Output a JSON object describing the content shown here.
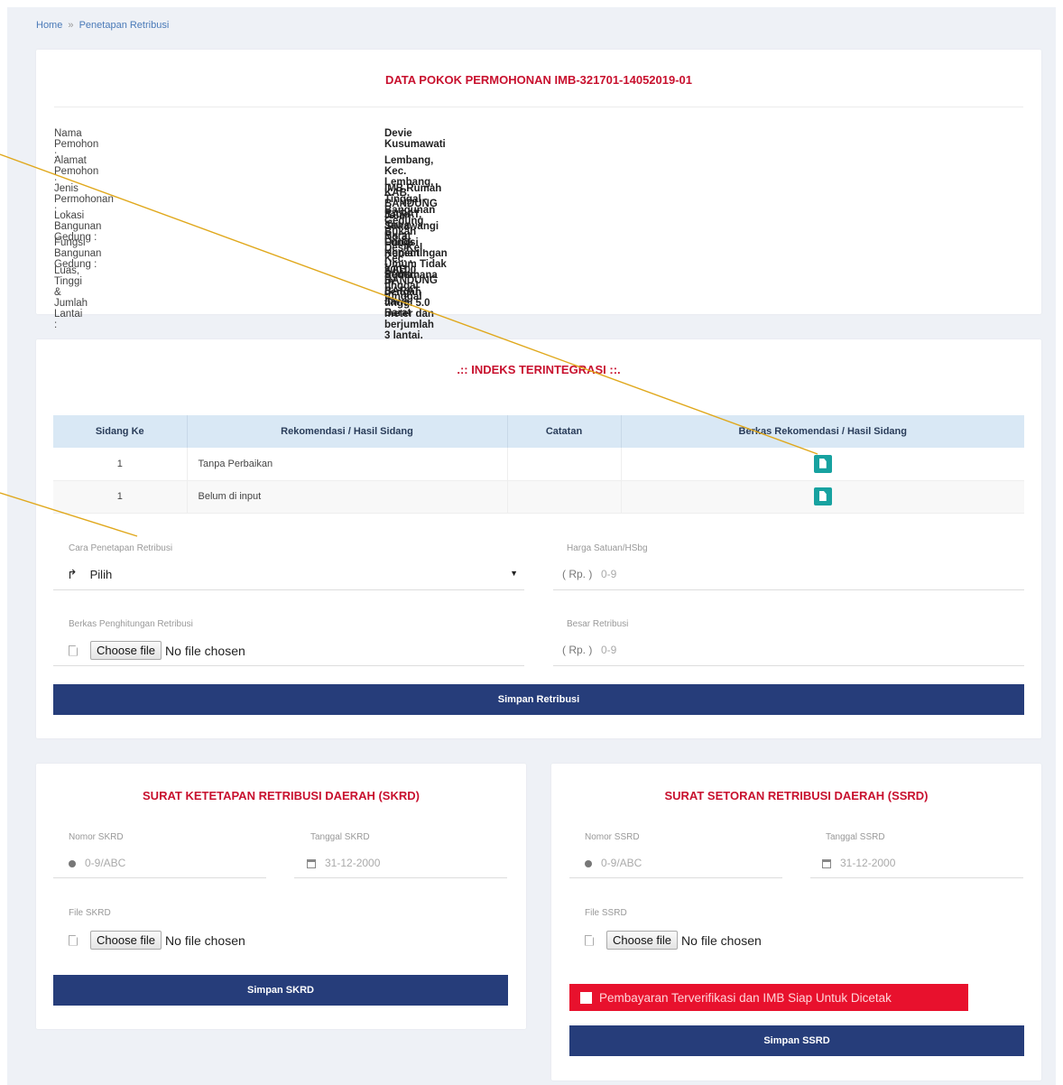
{
  "breadcrumb": {
    "home": "Home",
    "sep": "»",
    "current": "Penetapan Retribusi"
  },
  "data_pokok": {
    "title": "DATA POKOK PERMOHONAN IMB-321701-14052019-01",
    "rows": [
      {
        "label": "Nama Pemohon :",
        "value": "Devie Kusumawati"
      },
      {
        "label": "Alamat Pemohon :",
        "value": "Lembang, Kec. Lembang, KAB. BANDUNG BARAT, Jawa Barat"
      },
      {
        "label": "Jenis Permohonan :",
        "value": "IMB Rumah Tinggal - Bangunan Gedung Bukan Untuk Kepentingan Umum Tidak Sederhana"
      },
      {
        "label": "Lokasi Bangunan Gedung :",
        "value": "Jalan Sukawangi No 3, Des/Kel. Kec. , KAB. BANDUNG BARAT, Jawa Barat"
      },
      {
        "label": "Fungsi Bangunan Gedung :",
        "value": "Fungsi Hunian - Rumah tinggal tunggal"
      },
      {
        "label": "Luas, Tinggi & Jumlah Lantai :",
        "value": "200.00 m², dengan tinggi 5.0 meter dan berjumlah 3 lantai."
      }
    ]
  },
  "indeks": {
    "title": ".:: INDEKS TERINTEGRASI ::.",
    "headers": [
      "Sidang Ke",
      "Rekomendasi / Hasil Sidang",
      "Catatan",
      "Berkas Rekomendasi / Hasil Sidang"
    ],
    "rows": [
      {
        "sidang": "1",
        "hasil": "Tanpa Perbaikan",
        "catatan": ""
      },
      {
        "sidang": "1",
        "hasil": "Belum di input",
        "catatan": ""
      }
    ],
    "doc_icon": "document-icon"
  },
  "retribusi": {
    "cara_label": "Cara Penetapan Retribusi",
    "cara_value": "Pilih",
    "harga_label": "Harga Satuan/HSbg",
    "harga_prefix": "( Rp. )",
    "harga_placeholder": "0-9",
    "berkas_label": "Berkas Penghitungan Retribusi",
    "choose_file": "Choose file",
    "no_file": "No file chosen",
    "besar_label": "Besar Retribusi",
    "besar_prefix": "( Rp. )",
    "besar_placeholder": "0-9",
    "save_label": "Simpan Retribusi"
  },
  "skrd": {
    "title": "SURAT KETETAPAN RETRIBUSI DAERAH (SKRD)",
    "nomor_label": "Nomor SKRD",
    "nomor_placeholder": "0-9/ABC",
    "tanggal_label": "Tanggal SKRD",
    "tanggal_placeholder": "31-12-2000",
    "file_label": "File SKRD",
    "choose_file": "Choose file",
    "no_file": "No file chosen",
    "save_label": "Simpan SKRD"
  },
  "ssrd": {
    "title": "SURAT SETORAN RETRIBUSI DAERAH (SSRD)",
    "nomor_label": "Nomor SSRD",
    "nomor_placeholder": "0-9/ABC",
    "tanggal_label": "Tanggal SSRD",
    "tanggal_placeholder": "31-12-2000",
    "file_label": "File SSRD",
    "choose_file": "Choose file",
    "no_file": "No file chosen",
    "verify_label": "Pembayaran Terverifikasi dan IMB Siap Untuk Dicetak",
    "save_label": "Simpan SSRD"
  },
  "colors": {
    "accent_red": "#c8102e",
    "primary_blue": "#263d7a",
    "teal": "#17a2a0",
    "annotation": "#e0a81c"
  }
}
